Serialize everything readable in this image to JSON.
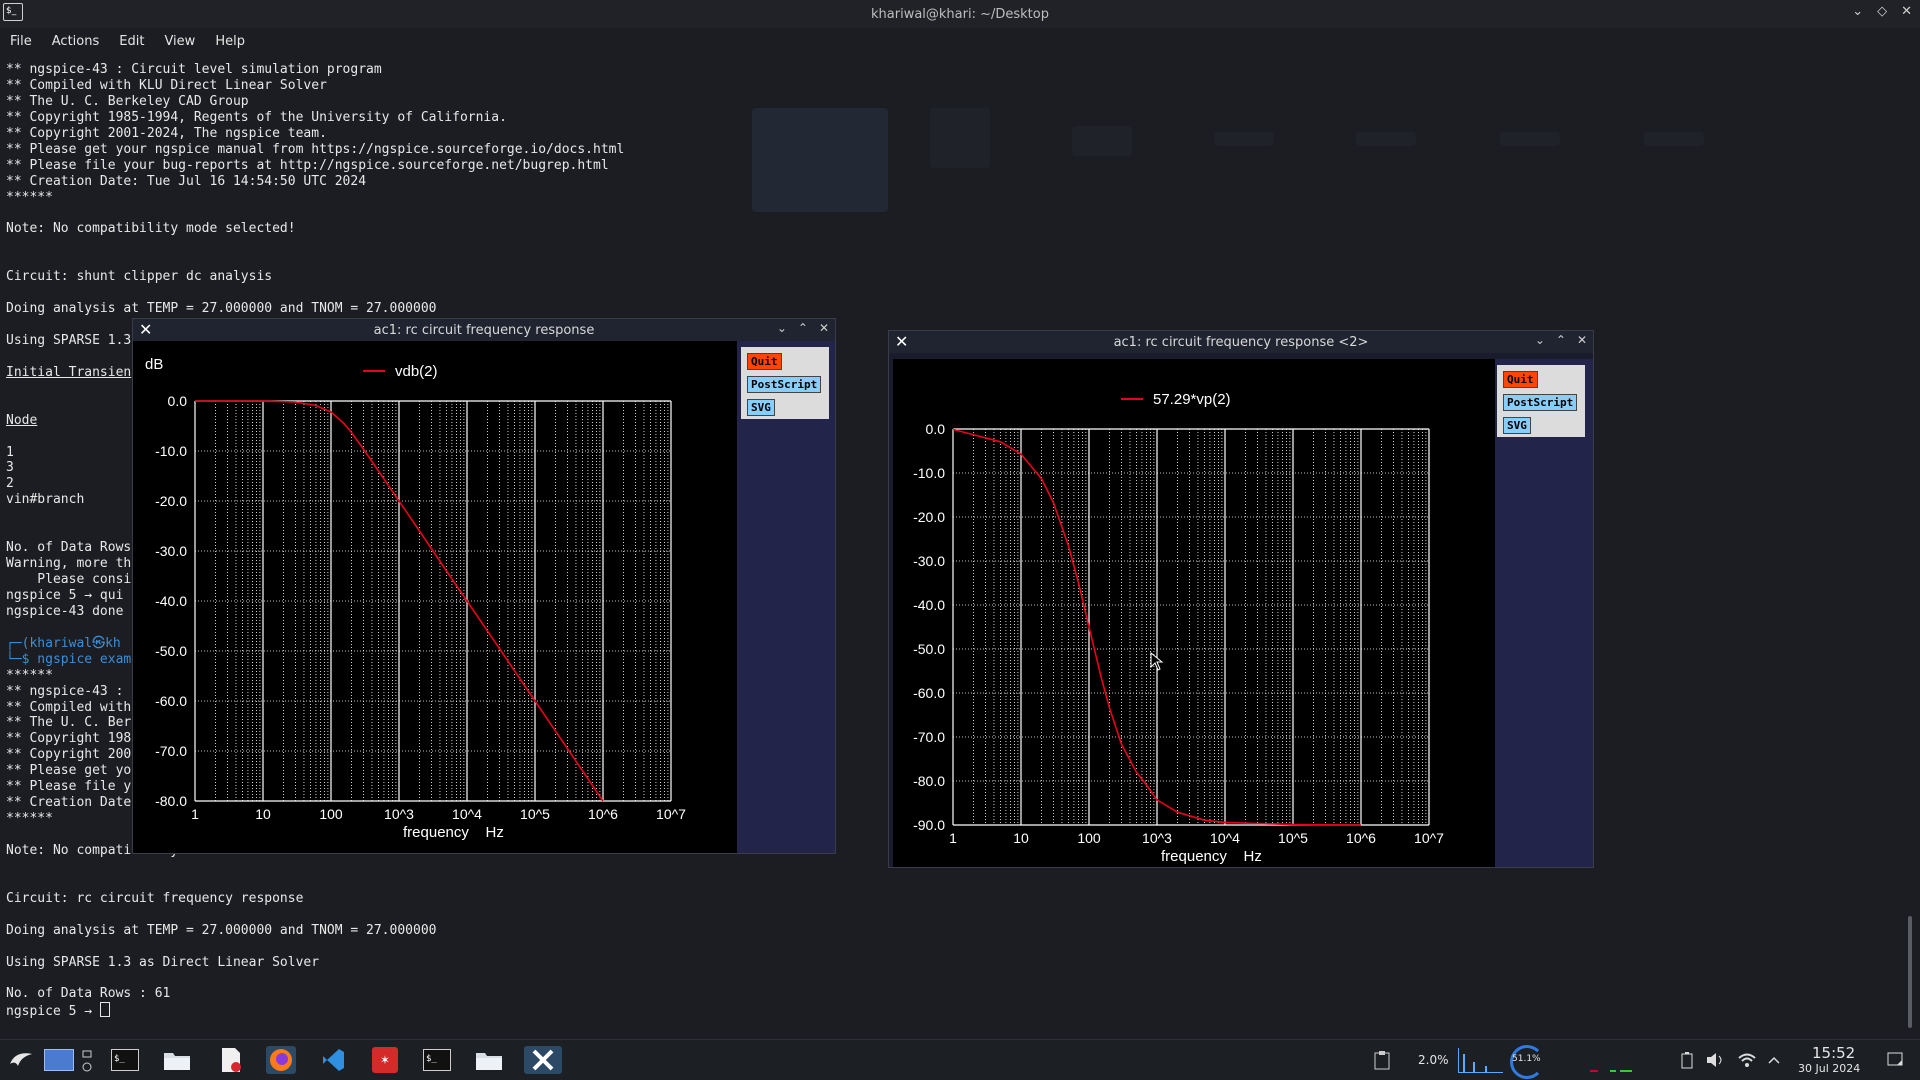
{
  "terminal": {
    "window_title": "khariwal@khari: ~/Desktop",
    "menu": [
      "File",
      "Actions",
      "Edit",
      "View",
      "Help"
    ],
    "lines": [
      "** ngspice-43 : Circuit level simulation program",
      "** Compiled with KLU Direct Linear Solver",
      "** The U. C. Berkeley CAD Group",
      "** Copyright 1985-1994, Regents of the University of California.",
      "** Copyright 2001-2024, The ngspice team.",
      "** Please get your ngspice manual from https://ngspice.sourceforge.io/docs.html",
      "** Please file your bug-reports at http://ngspice.sourceforge.net/bugrep.html",
      "** Creation Date: Tue Jul 16 14:54:50 UTC 2024",
      "******",
      "",
      "Note: No compatibility mode selected!",
      "",
      "",
      "Circuit: shunt clipper dc analysis",
      "",
      "Doing analysis at TEMP = 27.000000 and TNOM = 27.000000",
      "",
      "Using SPARSE 1.3",
      "",
      "Initial Transien",
      "",
      "",
      "Node",
      "",
      "1",
      "3",
      "2",
      "vin#branch",
      "",
      "",
      "No. of Data Rows",
      "Warning, more th",
      "    Please consi",
      "ngspice 5 → qui",
      "ngspice-43 done",
      "",
      "┌─(khariwal㉿kh",
      "└─$ ngspice exam",
      "******",
      "** ngspice-43 :",
      "** Compiled with",
      "** The U. C. Ber",
      "** Copyright 198",
      "** Copyright 200",
      "** Please get yo",
      "** Please file y",
      "** Creation Date",
      "******",
      "",
      "Note: No compatibility mode selected!",
      "",
      "",
      "Circuit: rc circuit frequency response",
      "",
      "Doing analysis at TEMP = 27.000000 and TNOM = 27.000000",
      "",
      "Using SPARSE 1.3 as Direct Linear Solver",
      "",
      "No. of Data Rows : 61",
      "ngspice 5 → "
    ]
  },
  "plot1": {
    "window_title": "ac1: rc circuit frequency response",
    "buttons": {
      "quit": "Quit",
      "postscript": "PostScript",
      "svg": "SVG"
    }
  },
  "plot2": {
    "window_title": "ac1: rc circuit frequency response <2>",
    "buttons": {
      "quit": "Quit",
      "postscript": "PostScript",
      "svg": "SVG"
    }
  },
  "taskbar": {
    "cpu": "2.0%",
    "battery": "51.1%",
    "time": "15:52",
    "date": "30 Jul 2024"
  },
  "colors": {
    "trace": "#e8001c",
    "grid": "#ffffff",
    "plot_bg": "#000000",
    "quit": "#ff4500",
    "button": "#87cefa"
  },
  "chart_data": [
    {
      "type": "line",
      "title": "",
      "ylabel": "dB",
      "xlabel": "frequency    Hz",
      "x_scale": "log",
      "xlim": [
        1,
        10000000
      ],
      "ylim": [
        -80,
        0
      ],
      "x_ticks": [
        "1",
        "10",
        "100",
        "10^3",
        "10^4",
        "10^5",
        "10^6",
        "10^7"
      ],
      "y_ticks": [
        "0.0",
        "-10.0",
        "-20.0",
        "-30.0",
        "-40.0",
        "-50.0",
        "-60.0",
        "-70.0",
        "-80.0"
      ],
      "grid": true,
      "legend": "top-center",
      "series": [
        {
          "name": "vdb(2)",
          "x": [
            1,
            10,
            30,
            60,
            100,
            150,
            200,
            300,
            500,
            1000,
            2000,
            5000,
            10000,
            30000,
            100000,
            300000,
            1000000
          ],
          "y": [
            0,
            -0.03,
            -0.2,
            -0.9,
            -2.2,
            -4.3,
            -6.3,
            -9.6,
            -14.0,
            -20.0,
            -26.0,
            -34.0,
            -40.0,
            -49.5,
            -60.0,
            -69.5,
            -80.0
          ]
        }
      ]
    },
    {
      "type": "line",
      "title": "",
      "ylabel": "",
      "xlabel": "frequency    Hz",
      "x_scale": "log",
      "xlim": [
        1,
        10000000
      ],
      "ylim": [
        -90,
        0
      ],
      "x_ticks": [
        "1",
        "10",
        "100",
        "10^3",
        "10^4",
        "10^5",
        "10^6",
        "10^7"
      ],
      "y_ticks": [
        "0.0",
        "-10.0",
        "-20.0",
        "-30.0",
        "-40.0",
        "-50.0",
        "-60.0",
        "-70.0",
        "-80.0",
        "-90.0"
      ],
      "grid": true,
      "legend": "top-center",
      "series": [
        {
          "name": "57.29*vp(2)",
          "x": [
            1,
            5,
            10,
            20,
            30,
            50,
            70,
            100,
            150,
            200,
            300,
            500,
            700,
            1000,
            2000,
            5000,
            10000,
            100000,
            1000000
          ],
          "y": [
            -0.1,
            -2.9,
            -5.7,
            -11.3,
            -16.7,
            -26.6,
            -35.0,
            -45.0,
            -56.3,
            -63.4,
            -71.6,
            -78.0,
            -80.9,
            -84.3,
            -87.1,
            -88.9,
            -89.4,
            -89.9,
            -90.0
          ]
        }
      ]
    }
  ]
}
